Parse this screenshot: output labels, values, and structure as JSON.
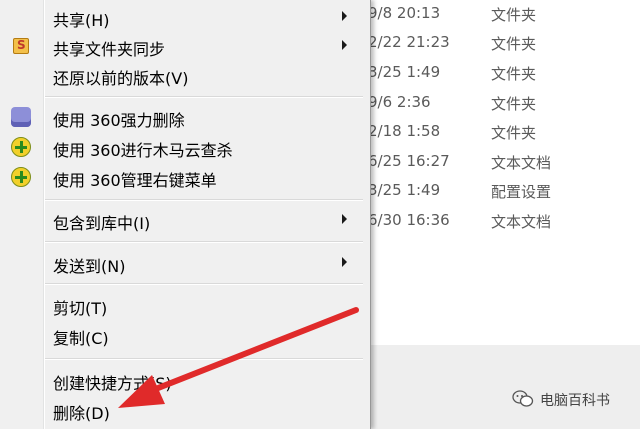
{
  "file_list": {
    "rows": [
      {
        "date": "9/8 20:13",
        "type": "文件夹"
      },
      {
        "date": "2/22 21:23",
        "type": "文件夹"
      },
      {
        "date": "3/25 1:49",
        "type": "文件夹"
      },
      {
        "date": "9/6 2:36",
        "type": "文件夹"
      },
      {
        "date": "2/18 1:58",
        "type": "文件夹"
      },
      {
        "date": "6/25 16:27",
        "type": "文本文档"
      },
      {
        "date": "3/25 1:49",
        "type": "配置设置"
      },
      {
        "date": "6/30 16:36",
        "type": "文本文档"
      }
    ]
  },
  "context_menu": {
    "items": [
      {
        "label": "共享(H)",
        "icon": null,
        "submenu": true
      },
      {
        "label": "共享文件夹同步",
        "icon": "sync-s-icon",
        "submenu": true
      },
      {
        "label": "还原以前的版本(V)",
        "icon": null,
        "submenu": false
      },
      {
        "label": "使用 360强力删除",
        "icon": "shredder-icon",
        "submenu": false
      },
      {
        "label": "使用 360进行木马云查杀",
        "icon": "360-plus-icon",
        "submenu": false
      },
      {
        "label": "使用 360管理右键菜单",
        "icon": "360-plus-icon",
        "submenu": false
      },
      {
        "label": "包含到库中(I)",
        "icon": null,
        "submenu": true
      },
      {
        "label": "发送到(N)",
        "icon": null,
        "submenu": true
      },
      {
        "label": "剪切(T)",
        "icon": null,
        "submenu": false
      },
      {
        "label": "复制(C)",
        "icon": null,
        "submenu": false
      },
      {
        "label": "创建快捷方式(S)",
        "icon": null,
        "submenu": false
      },
      {
        "label": "删除(D)",
        "icon": null,
        "submenu": false
      }
    ],
    "sync_icon_letter": "S"
  },
  "watermark": {
    "text": "电脑百科书",
    "icon": "wechat-icon"
  },
  "colors": {
    "arrow": "#e02a2a",
    "menu_bg": "#f0f0f0"
  }
}
